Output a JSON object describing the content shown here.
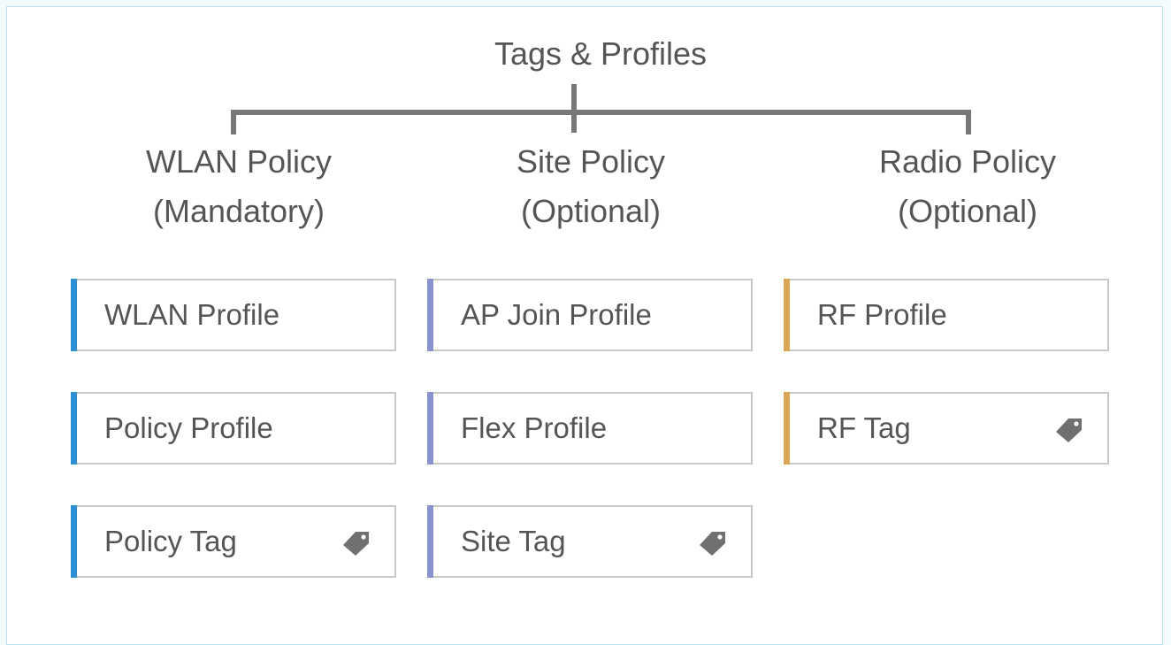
{
  "title": "Tags & Profiles",
  "colors": {
    "wlan_accent": "#2d8fd6",
    "site_accent": "#8892cf",
    "radio_accent": "#d9a657",
    "connector": "#777777",
    "text": "#555555",
    "card_border": "#c8c8c8"
  },
  "columns": [
    {
      "heading": "WLAN Policy",
      "subheading": "(Mandatory)",
      "items": [
        {
          "label": "WLAN Profile",
          "icon": null
        },
        {
          "label": "Policy Profile",
          "icon": null
        },
        {
          "label": "Policy Tag",
          "icon": "tag-icon"
        }
      ]
    },
    {
      "heading": "Site Policy",
      "subheading": "(Optional)",
      "items": [
        {
          "label": "AP Join Profile",
          "icon": null
        },
        {
          "label": "Flex Profile",
          "icon": null
        },
        {
          "label": "Site Tag",
          "icon": "tag-icon"
        }
      ]
    },
    {
      "heading": "Radio Policy",
      "subheading": "(Optional)",
      "items": [
        {
          "label": "RF Profile",
          "icon": null
        },
        {
          "label": "RF Tag",
          "icon": "tag-icon"
        }
      ]
    }
  ]
}
